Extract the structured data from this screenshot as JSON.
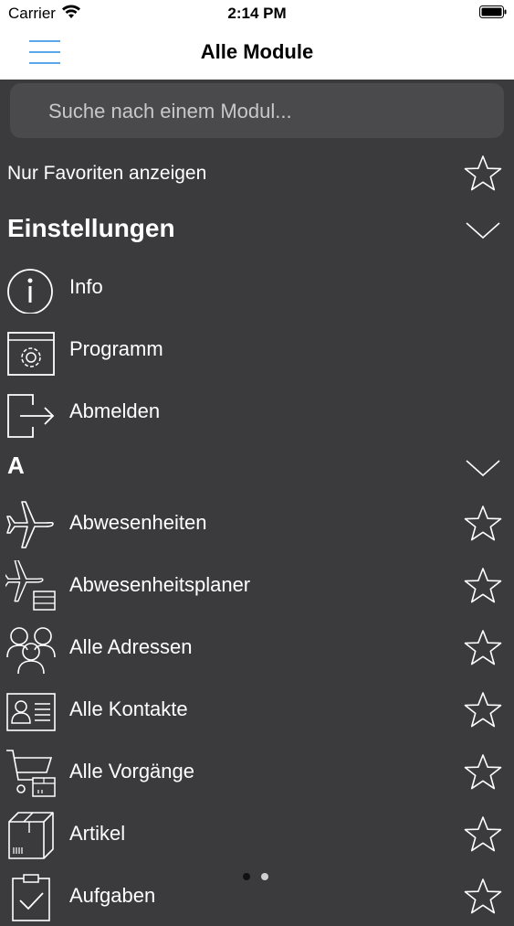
{
  "status_bar": {
    "carrier": "Carrier",
    "time": "2:14 PM"
  },
  "header": {
    "title": "Alle Module"
  },
  "search": {
    "placeholder": "Suche nach einem Modul..."
  },
  "favorites_toggle": {
    "label": "Nur Favoriten anzeigen"
  },
  "sections": {
    "settings": {
      "title": "Einstellungen",
      "items": [
        {
          "label": "Info",
          "icon": "info-icon"
        },
        {
          "label": "Programm",
          "icon": "program-settings-icon"
        },
        {
          "label": "Abmelden",
          "icon": "logout-icon"
        }
      ]
    },
    "a": {
      "title": "A",
      "items": [
        {
          "label": "Abwesenheiten",
          "icon": "airplane-icon"
        },
        {
          "label": "Abwesenheitsplaner",
          "icon": "airplane-planner-icon"
        },
        {
          "label": "Alle Adressen",
          "icon": "people-icon"
        },
        {
          "label": "Alle Kontakte",
          "icon": "contact-card-icon"
        },
        {
          "label": "Alle Vorgänge",
          "icon": "shopping-cart-icon"
        },
        {
          "label": "Artikel",
          "icon": "package-box-icon"
        },
        {
          "label": "Aufgaben",
          "icon": "clipboard-check-icon"
        }
      ]
    }
  },
  "page_indicator": {
    "pages": 2,
    "current": 1
  },
  "colors": {
    "background": "#3b3a3d",
    "accent": "#5aa8ea",
    "text": "#ffffff"
  }
}
